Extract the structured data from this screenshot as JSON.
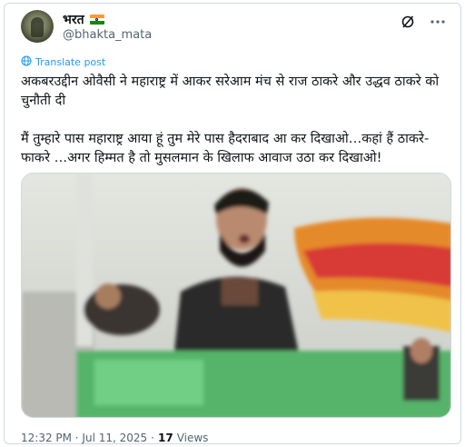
{
  "tweet": {
    "author_name": "भरत",
    "author_handle": "@bhakta_mata",
    "translate_label": "Translate post",
    "text": "अकबरउद्दीन ओवैसी ने महाराष्ट्र में आकर सरेआम मंच से राज ठाकरे और उद्धव ठाकरे को चुनौती दी\n\nमैं तुम्हारे पास महाराष्ट्र आया हूं तुम मेरे पास हैदराबाद आ कर दिखाओ…कहां हैं ठाकरे-फाकरे …अगर हिम्मत है तो मुसलमान के खिलाफ आवाज उठा कर दिखाओ!",
    "timestamp": "12:32 PM · Jul 11, 2025",
    "separator": "·",
    "views_count": "17",
    "views_label": "Views"
  },
  "icons": {
    "flag": "india-flag-icon",
    "grok": "grok-icon",
    "more": "more-icon",
    "translate": "globe-icon"
  },
  "colors": {
    "accent": "#1d9bf0",
    "secondary_text": "#536471",
    "primary_text": "#0f1419",
    "border": "#cfd9de"
  }
}
